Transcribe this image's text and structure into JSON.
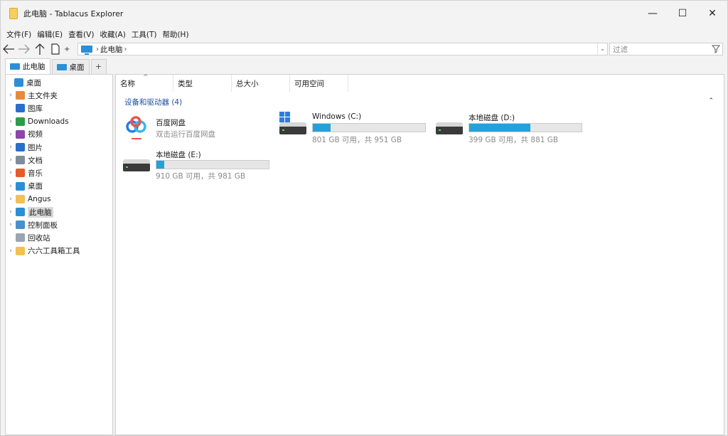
{
  "window": {
    "title": "此电脑 - Tablacus Explorer",
    "controls": {
      "minimize": "—",
      "maximize": "☐",
      "close": "✕"
    }
  },
  "menu": [
    "文件(F)",
    "编辑(E)",
    "查看(V)",
    "收藏(A)",
    "工具(T)",
    "帮助(H)"
  ],
  "nav": {
    "back": "back-arrow-icon",
    "forward": "forward-arrow-icon",
    "up": "up-arrow-icon",
    "address": {
      "location": "此电脑",
      "separator": "›"
    },
    "filter_placeholder": "过滤"
  },
  "tabs": [
    {
      "label": "此电脑",
      "active": true
    },
    {
      "label": "桌面",
      "active": false
    }
  ],
  "tab_add": "+",
  "tree": [
    {
      "label": "桌面",
      "icon": "desktop-icon",
      "color": "#2c8fd6",
      "indent": 0,
      "expander": ""
    },
    {
      "label": "主文件夹",
      "icon": "home-icon",
      "color": "#e9893a",
      "indent": 1,
      "expander": "›"
    },
    {
      "label": "图库",
      "icon": "gallery-icon",
      "color": "#2a6fc9",
      "indent": 1,
      "expander": ""
    },
    {
      "label": "Downloads",
      "icon": "download-icon",
      "color": "#2b9c4a",
      "indent": 1,
      "expander": "›"
    },
    {
      "label": "视频",
      "icon": "video-icon",
      "color": "#8e44ad",
      "indent": 1,
      "expander": "›"
    },
    {
      "label": "图片",
      "icon": "picture-icon",
      "color": "#2a6fc9",
      "indent": 1,
      "expander": "›"
    },
    {
      "label": "文档",
      "icon": "document-icon",
      "color": "#7f8c9a",
      "indent": 1,
      "expander": "›"
    },
    {
      "label": "音乐",
      "icon": "music-icon",
      "color": "#e55b2c",
      "indent": 1,
      "expander": "›"
    },
    {
      "label": "桌面",
      "icon": "desktop-icon",
      "color": "#2c8fd6",
      "indent": 1,
      "expander": "›"
    },
    {
      "label": "Angus",
      "icon": "folder-icon",
      "color": "#f2c14e",
      "indent": 1,
      "expander": "›"
    },
    {
      "label": "此电脑",
      "icon": "computer-icon",
      "color": "#2c8fd6",
      "indent": 1,
      "expander": "›",
      "selected": true
    },
    {
      "label": "控制面板",
      "icon": "control-panel-icon",
      "color": "#4a90c9",
      "indent": 1,
      "expander": "›"
    },
    {
      "label": "回收站",
      "icon": "recycle-bin-icon",
      "color": "#9aa5b1",
      "indent": 1,
      "expander": ""
    },
    {
      "label": "六六工具箱工具",
      "icon": "folder-icon",
      "color": "#f2c14e",
      "indent": 1,
      "expander": "›"
    }
  ],
  "columns": [
    {
      "label": "名称",
      "sorted": true
    },
    {
      "label": "类型"
    },
    {
      "label": "总大小"
    },
    {
      "label": "可用空间"
    }
  ],
  "group": {
    "title": "设备和驱动器 (4)",
    "collapse": "⌃"
  },
  "drives": [
    {
      "name": "百度网盘",
      "sub": "双击运行百度网盘",
      "icon": "baidu-netdisk-icon"
    },
    {
      "name": "Windows (C:)",
      "sub": "801 GB 可用，共 951 GB",
      "used_fraction": 0.158,
      "icon": "windows-drive-icon"
    },
    {
      "name": "本地磁盘 (D:)",
      "sub": "399 GB 可用，共 881 GB",
      "used_fraction": 0.547,
      "icon": "hard-drive-icon"
    },
    {
      "name": "本地磁盘 (E:)",
      "sub": "910 GB 可用，共 981 GB",
      "used_fraction": 0.072,
      "icon": "hard-drive-icon"
    }
  ],
  "colors": {
    "accent": "#26a0da",
    "group_header": "#1d4fa0"
  }
}
